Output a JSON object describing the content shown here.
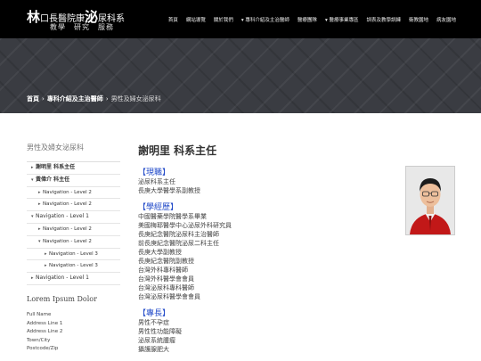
{
  "header": {
    "logo_char1": "林",
    "logo_text1": "口長",
    "logo_text2": "醫院康",
    "logo_char2": "泌",
    "logo_text3": "尿科系",
    "slogan": "教學　研究　服務",
    "nav": [
      "首頁",
      "網站導覽",
      "關於我們",
      "▾ 專科介紹及主治醫師",
      "醫療團隊",
      "▾ 醫療事業專區",
      "訓表及教學訓練",
      "衛教園地",
      "病友園地"
    ]
  },
  "breadcrumb": {
    "home": "首頁",
    "sep1": "›",
    "level1": "專科介紹及主治醫師",
    "sep2": "›",
    "current": "男性及婦女泌尿科"
  },
  "sidebar": {
    "title": "男性及婦女泌尿科",
    "items": [
      {
        "label": "謝明里 科系主任"
      },
      {
        "label": "黃偉介 科主任"
      },
      {
        "label": "Navigation - Level 2"
      },
      {
        "label": "Navigation - Level 2"
      },
      {
        "label": "Navigation - Level 1"
      },
      {
        "label": "Navigation - Level 2"
      },
      {
        "label": "Navigation - Level 2"
      },
      {
        "label": "Navigation - Level 3"
      },
      {
        "label": "Navigation - Level 3"
      },
      {
        "label": "Navigation - Level 1"
      }
    ],
    "widget_title": "Lorem Ipsum Dolor",
    "address": [
      "Full Name",
      "Address Line 1",
      "Address Line 2",
      "Town/City",
      "Postcode/Zip"
    ]
  },
  "main": {
    "title": "謝明里 科系主任",
    "sections": [
      {
        "heading": "【現職】",
        "lines": [
          "泌尿科系主任",
          "長庚大學醫學系副教授"
        ]
      },
      {
        "heading": "【學經歷】",
        "lines": [
          "中國醫藥學院醫學系畢業",
          "美國梅耶醫學中心泌尿外科研究員",
          "長庚紀念醫院泌尿科主治醫師",
          "前長庚紀念醫院泌尿二科主任",
          "長庚大學副教授",
          "長庚紀念醫院副教授",
          "台灣外科專科醫師",
          "台灣外科醫學會會員",
          "台灣泌尿科專科醫師",
          "台灣泌尿科醫學會會員"
        ]
      },
      {
        "heading": "【專長】",
        "lines": [
          "男性不孕症",
          "男性性功能障礙",
          "泌尿系統腫瘤",
          "攝護腺肥大"
        ]
      }
    ]
  }
}
